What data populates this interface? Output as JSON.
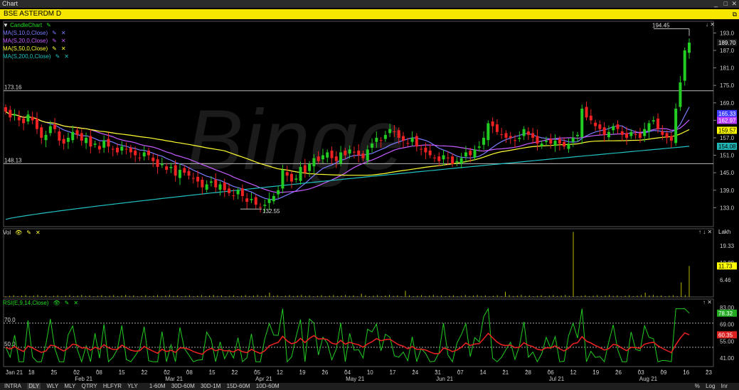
{
  "window": {
    "title": "Chart",
    "min": "_",
    "max": "□",
    "close": "✕"
  },
  "symbol": {
    "label": "BSE ASTERDM D",
    "pin_icon": "pin-icon"
  },
  "legend_main": [
    {
      "label": "CandleChart",
      "color": "#22dd22"
    },
    {
      "label": "MA(S,10,0,Close)",
      "color": "#7b7bff"
    },
    {
      "label": "MA(S,20,0,Close)",
      "color": "#c55cff"
    },
    {
      "label": "MA(S,50,0,Close)",
      "color": "#ffff33"
    },
    {
      "label": "MA(S,200,0,Close)",
      "color": "#22c0c0"
    }
  ],
  "legend_vol": {
    "label": "Vol"
  },
  "legend_rsi": {
    "label": "RSI(E,9,14,Close)"
  },
  "bottom": {
    "periods": [
      "INTRA",
      "DLY",
      "WLY",
      "MLY",
      "QTRY",
      "HLFYR",
      "YLY"
    ],
    "selected": "DLY",
    "intraday": [
      "1-60M",
      "30D-60M",
      "30D-1M",
      "15D-60M",
      "10D-60M"
    ],
    "right": [
      "%",
      "Log",
      "Inr"
    ]
  },
  "chart_data": [
    {
      "type": "candlestick",
      "title": "BSE ASTERDM D",
      "y_ticks": [
        193.0,
        187.0,
        181.0,
        175.0,
        169.0,
        163.0,
        157.0,
        151.0,
        145.0,
        139.0,
        133.0
      ],
      "ylim": [
        126.5,
        197.0
      ],
      "horizontal_lines": [
        173.16,
        148.13
      ],
      "annotations": [
        {
          "text": "194.45",
          "value": 194.45
        },
        {
          "text": "132.55",
          "value": 132.55
        }
      ],
      "price_labels": [
        {
          "text": "189.70",
          "value": 189.7,
          "bg": "#1a1a1a",
          "fg": "#ffffff"
        },
        {
          "text": "165.33",
          "value": 165.33,
          "bg": "#3c3cff",
          "fg": "#ffffff"
        },
        {
          "text": "162.97",
          "value": 162.97,
          "bg": "#b43cff",
          "fg": "#ffffff"
        },
        {
          "text": "159.57",
          "value": 159.57,
          "bg": "#ffff00",
          "fg": "#000000"
        },
        {
          "text": "154.08",
          "value": 154.08,
          "bg": "#20b4b4",
          "fg": "#000000"
        }
      ],
      "closes": [
        166,
        164,
        165,
        163,
        162,
        165,
        163,
        160,
        157,
        158,
        161,
        160,
        156,
        155,
        157,
        159,
        158,
        156,
        157,
        154,
        155,
        153,
        156,
        154,
        153,
        152,
        154,
        153,
        152,
        151,
        150,
        152,
        151,
        149,
        147,
        148,
        146,
        147,
        144,
        146,
        145,
        144,
        143,
        142,
        140,
        141,
        142,
        140,
        141,
        139,
        138,
        137,
        139,
        137,
        135,
        136,
        134,
        133,
        134,
        136,
        137,
        139,
        146,
        144,
        142,
        143,
        147,
        145,
        148,
        150,
        149,
        151,
        152,
        150,
        149,
        152,
        151,
        153,
        152,
        151,
        150,
        153,
        155,
        157,
        156,
        158,
        160,
        159,
        157,
        156,
        155,
        157,
        154,
        153,
        152,
        151,
        150,
        149,
        151,
        150,
        148,
        149,
        150,
        152,
        151,
        153,
        154,
        157,
        162,
        161,
        159,
        158,
        157,
        157,
        156,
        157,
        160,
        158,
        157,
        155,
        155,
        156,
        155,
        156,
        155,
        154,
        155,
        157,
        158,
        167,
        164,
        163,
        161,
        160,
        158,
        159,
        161,
        160,
        158,
        157,
        159,
        158,
        157,
        160,
        162,
        163,
        160,
        158,
        157,
        156,
        167,
        176,
        187,
        189.7
      ],
      "series": [
        {
          "name": "MA(S,10,0,Close)",
          "last": 165.33
        },
        {
          "name": "MA(S,20,0,Close)",
          "last": 162.97
        },
        {
          "name": "MA(S,50,0,Close)",
          "last": 159.57
        },
        {
          "name": "MA(S,200,0,Close)",
          "last": 154.08
        }
      ],
      "x_tick_labels": [
        "Jan 21",
        "18",
        "25",
        "02",
        "08",
        "15",
        "22",
        "02",
        "08",
        "15",
        "22",
        "05",
        "12",
        "19",
        "26",
        "04",
        "10",
        "17",
        "24",
        "31",
        "07",
        "14",
        "21",
        "28",
        "06",
        "12",
        "19",
        "26",
        "03",
        "09",
        "16",
        "23"
      ],
      "x_month_labels": [
        "Jan 21",
        "Feb 21",
        "Mar 21",
        "Apr 21",
        "May 21",
        "Jun 21",
        "Jul 21",
        "Aug 21"
      ]
    },
    {
      "type": "bar",
      "title": "Vol",
      "unit": "Lakh",
      "y_ticks": [
        19.33,
        12.89,
        6.46
      ],
      "ylim": [
        0,
        25.8
      ],
      "last_label": "11.73",
      "last_value": 11.73,
      "spikes": [
        {
          "index": 66,
          "value": 1.6
        },
        {
          "index": 89,
          "value": 1.2
        },
        {
          "index": 100,
          "value": 2.3
        },
        {
          "index": 125,
          "value": 2.0
        },
        {
          "index": 142,
          "value": 24.6
        },
        {
          "index": 160,
          "value": 1.6
        },
        {
          "index": 169,
          "value": 5.5
        },
        {
          "index": 171,
          "value": 11.73
        }
      ]
    },
    {
      "type": "line",
      "title": "RSI(E,9,14,Close)",
      "y_ticks": [
        83.0,
        69.0,
        55.0,
        41.0
      ],
      "ylim": [
        34,
        90
      ],
      "levels": [
        70.0,
        50.0
      ],
      "level_labels": [
        "70.0",
        "50.0"
      ],
      "last_labels": [
        {
          "text": "78.32",
          "value": 78.32,
          "bg": "#22aa22"
        },
        {
          "text": "60.35",
          "value": 60.35,
          "bg": "#dd2222"
        }
      ]
    }
  ]
}
